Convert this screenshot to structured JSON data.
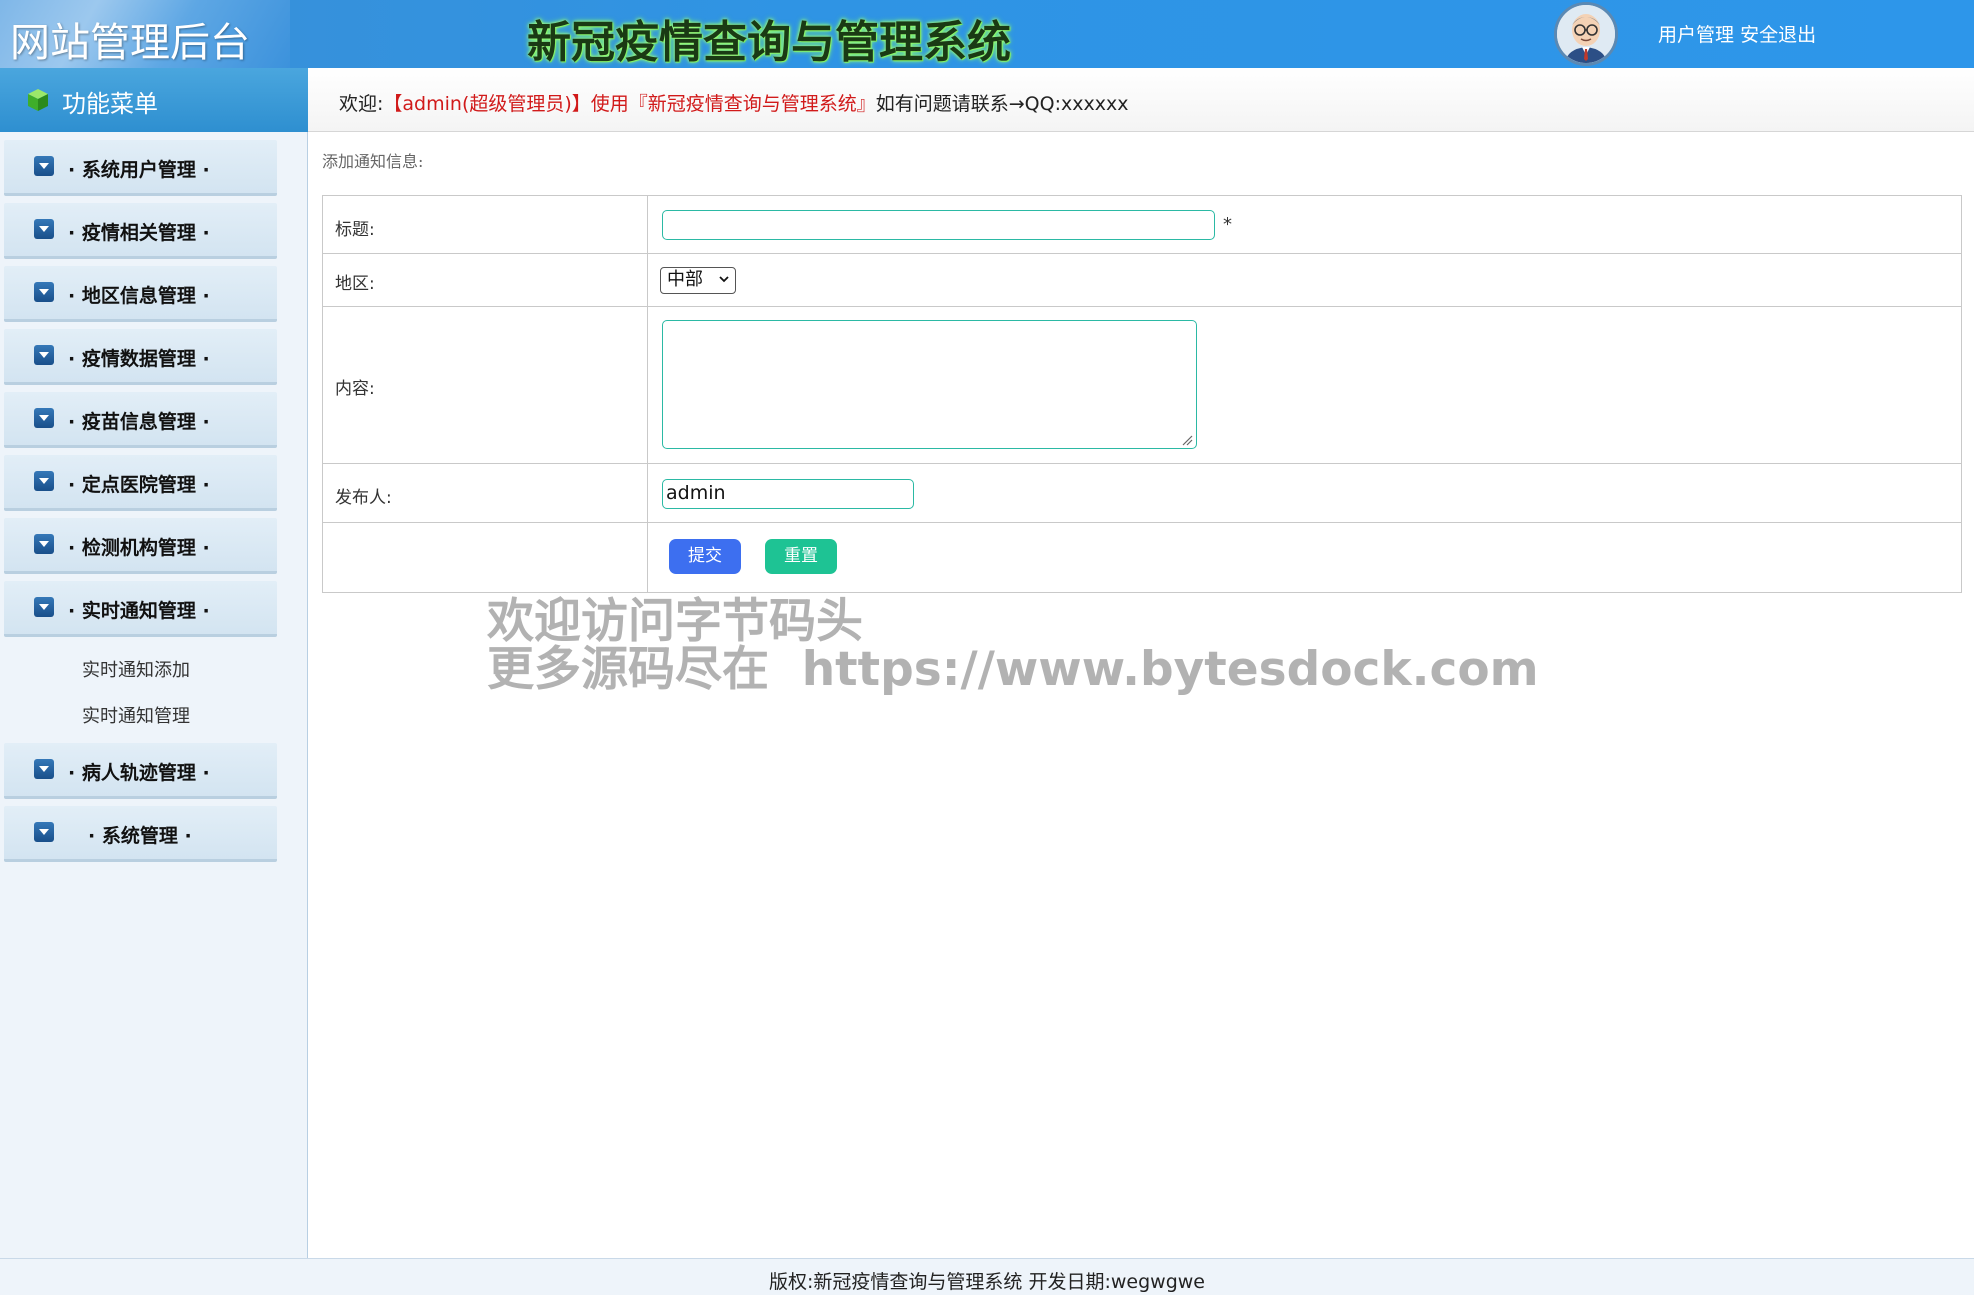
{
  "header": {
    "brand": "网站管理后台",
    "system_title": "新冠疫情查询与管理系统",
    "links": {
      "user_manage": "用户管理",
      "logout": "安全退出"
    }
  },
  "sidebar": {
    "menu_title": "功能菜单",
    "items": [
      {
        "label": "· 系统用户管理 ·"
      },
      {
        "label": "· 疫情相关管理 ·"
      },
      {
        "label": "· 地区信息管理 ·"
      },
      {
        "label": "· 疫情数据管理 ·"
      },
      {
        "label": "· 疫苗信息管理 ·"
      },
      {
        "label": "· 定点医院管理 ·"
      },
      {
        "label": "· 检测机构管理 ·"
      },
      {
        "label": "· 实时通知管理 ·"
      },
      {
        "label": "· 病人轨迹管理 ·"
      },
      {
        "label": "· 系统管理 ·"
      }
    ],
    "sub_items": [
      {
        "label": "实时通知添加"
      },
      {
        "label": "实时通知管理"
      }
    ]
  },
  "welcome": {
    "prefix": "欢迎:",
    "highlight": "【admin(超级管理员)】使用『新冠疫情查询与管理系统』",
    "suffix": "如有问题请联系→QQ:xxxxxx"
  },
  "form": {
    "caption": "添加通知信息:",
    "title_label": "标题:",
    "title_value": "",
    "required_mark": "*",
    "region_label": "地区:",
    "region_selected": "中部",
    "content_label": "内容:",
    "content_value": "",
    "publisher_label": "发布人:",
    "publisher_value": "admin",
    "submit_label": "提交",
    "reset_label": "重置"
  },
  "watermark": {
    "line1": "欢迎访问字节码头",
    "line2": "更多源码尽在  https://www.bytesdock.com"
  },
  "footer": {
    "text": "版权:新冠疫情查询与管理系统 开发日期:wegwgwe"
  },
  "colors": {
    "header_blue": "#2f94e4",
    "accent_red": "#d11a1a",
    "submit_blue": "#3d6ff0",
    "reset_green": "#1ec394",
    "input_border": "#2bb9a4"
  }
}
